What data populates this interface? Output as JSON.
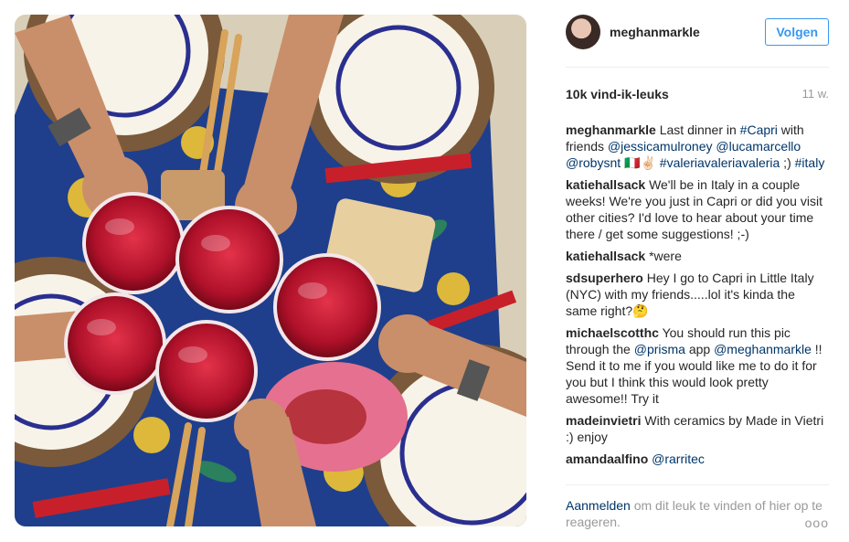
{
  "post": {
    "username": "meghanmarkle",
    "follow_label": "Volgen",
    "likes": "10k vind-ik-leuks",
    "time": "11 w.",
    "caption": {
      "user": "meghanmarkle",
      "t1": "Last dinner in ",
      "tag1": "#Capri",
      "t2": " with friends ",
      "m1": "@jessicamulroney",
      "m2": "@lucamarcello",
      "m3": "@robysnt",
      "emoji": "🇮🇹✌🏻",
      "tag2": "#valeriavaleriavaleria",
      "t3": " ;)",
      "tag3": "#italy"
    }
  },
  "comments": [
    {
      "user": "katiehallsack",
      "text": "We'll be in Italy in a couple weeks! We're you just in Capri or did you visit other cities? I'd love to hear about your time there / get some suggestions! ;-)"
    },
    {
      "user": "katiehallsack",
      "text": "*were"
    },
    {
      "user": "sdsuperhero",
      "text": "Hey I go to Capri in Little Italy (NYC) with my friends.....lol it's kinda the same right?🤔"
    },
    {
      "user": "michaelscotthc",
      "t1": "You should run this pic through the ",
      "m1": "@prisma",
      "t2": " app ",
      "m2": "@meghanmarkle",
      "t3": " !! Send it to me if you would like me to do it for you but I think this would look pretty awesome!! Try it"
    },
    {
      "user": "madeinvietri",
      "text": "With ceramics by Made in Vietri :) enjoy"
    },
    {
      "user": "amandaalfino",
      "m1": "@rarritec"
    }
  ],
  "footer": {
    "login_label": "Aanmelden",
    "text": " om dit leuk te vinden of hier op te reageren.",
    "more": "ooo"
  }
}
